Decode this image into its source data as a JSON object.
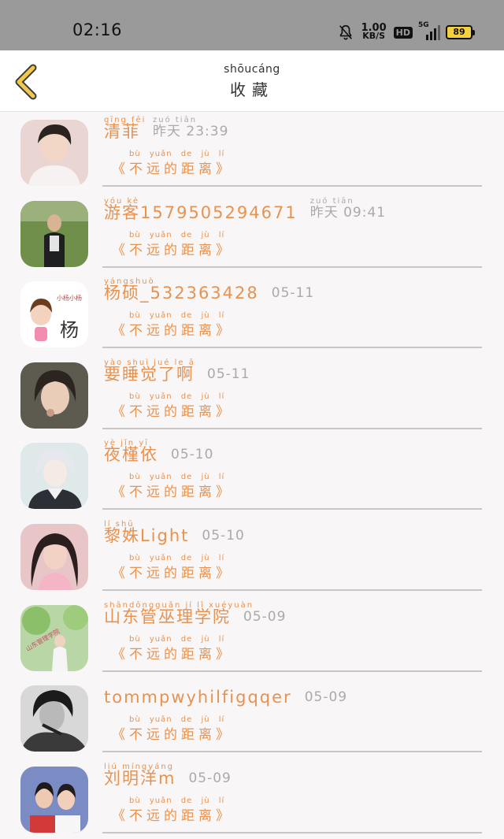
{
  "status_bar": {
    "time": "02:16",
    "net_speed_value": "1.00",
    "net_speed_unit": "KB/S",
    "hd": "HD",
    "signal_label": "5G",
    "battery": "89"
  },
  "header": {
    "title_pinyin": "shōucáng",
    "title": "收藏"
  },
  "slogan": {
    "pinyin": "bù yuǎn de jù lí",
    "text": "《不远的距离》"
  },
  "items": [
    {
      "name": "清菲",
      "name_pinyin": "qīng fēi",
      "date": "昨天 23:39",
      "date_pinyin": "zuó tiān"
    },
    {
      "name": "游客1579505294671",
      "name_pinyin": "yóu kè",
      "date": "昨天 09:41",
      "date_pinyin": "zuó tiān"
    },
    {
      "name": "杨硕_532363428",
      "name_pinyin": "yángshuò",
      "date": "05-11",
      "date_pinyin": ""
    },
    {
      "name": "要睡觉了啊",
      "name_pinyin": "yào shuì jué le ā",
      "date": "05-11",
      "date_pinyin": ""
    },
    {
      "name": "夜槿依",
      "name_pinyin": "yè jǐn yī",
      "date": "05-10",
      "date_pinyin": ""
    },
    {
      "name": "黎姝Light",
      "name_pinyin": "lí shū",
      "date": "05-10",
      "date_pinyin": ""
    },
    {
      "name": "山东管巫理学院",
      "name_pinyin": "shāndōngguǎn jí lǐ xuéyuàn",
      "date": "05-09",
      "date_pinyin": ""
    },
    {
      "name": "tommpwyhilfigqqer",
      "name_pinyin": "",
      "date": "05-09",
      "date_pinyin": ""
    },
    {
      "name": "刘明洋m",
      "name_pinyin": "liú míngyáng",
      "date": "05-09",
      "date_pinyin": ""
    }
  ],
  "colors": {
    "accent": "#e8924f",
    "muted": "#aaaaaa",
    "back_icon": "#f2c94c",
    "status_bar_bg": "#9a9a9a"
  }
}
